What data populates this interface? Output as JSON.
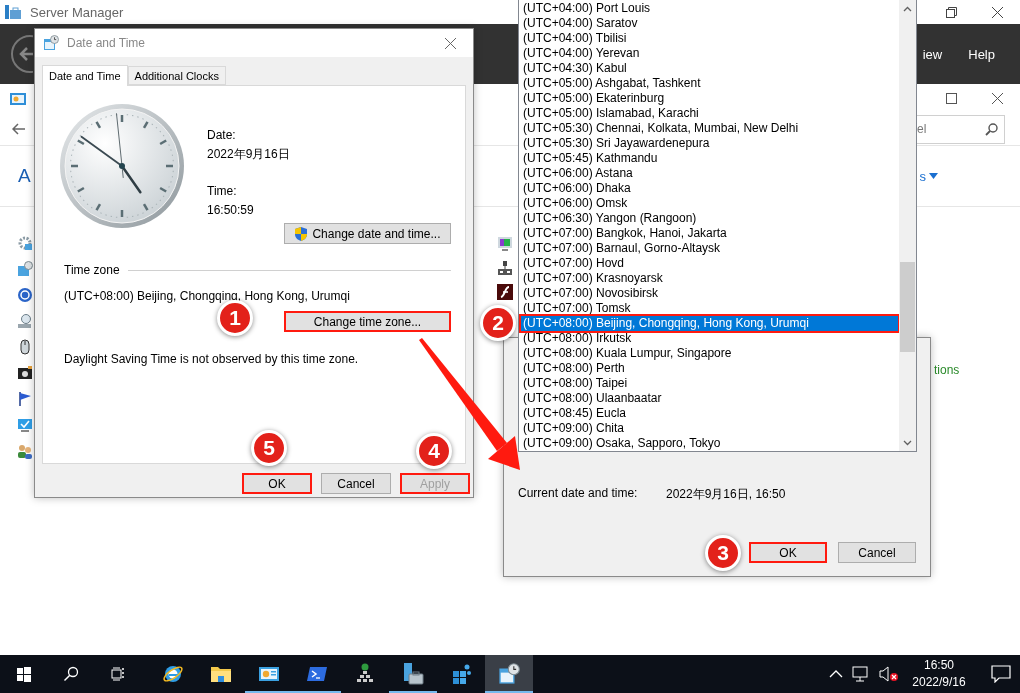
{
  "server_manager": {
    "title": "Server Manager",
    "menu": [
      "iew",
      "Help"
    ]
  },
  "control_panel": {
    "heading": "A",
    "search": {
      "placeholder": "el"
    },
    "view_link": "s",
    "side_link": "tions"
  },
  "date_time_dialog": {
    "title": "Date and Time",
    "tabs": [
      {
        "label": "Date and Time",
        "selected": true
      },
      {
        "label": "Additional Clocks",
        "selected": false
      }
    ],
    "date_label": "Date:",
    "date": "2022年9月16日",
    "time_label": "Time:",
    "time": "16:50:59",
    "change_date_button": {
      "label": "Change date and time...",
      "highlighted": false
    },
    "time_zone_heading": "Time zone",
    "time_zone": "(UTC+08:00) Beijing, Chongqing, Hong Kong, Urumqi",
    "change_zone_button": {
      "label": "Change time zone...",
      "highlighted": true
    },
    "dst_note": "Daylight Saving Time is not observed by this time zone.",
    "buttons": [
      {
        "label": "OK",
        "disabled": false,
        "highlighted": true
      },
      {
        "label": "Cancel",
        "disabled": false,
        "highlighted": false
      },
      {
        "label": "Apply",
        "disabled": true,
        "highlighted": true
      }
    ]
  },
  "time_zone_dialog": {
    "time_zones": [
      {
        "label": "(UTC+04:00) Port Louis",
        "selected": false
      },
      {
        "label": "(UTC+04:00) Saratov",
        "selected": false
      },
      {
        "label": "(UTC+04:00) Tbilisi",
        "selected": false
      },
      {
        "label": "(UTC+04:00) Yerevan",
        "selected": false
      },
      {
        "label": "(UTC+04:30) Kabul",
        "selected": false
      },
      {
        "label": "(UTC+05:00) Ashgabat, Tashkent",
        "selected": false
      },
      {
        "label": "(UTC+05:00) Ekaterinburg",
        "selected": false
      },
      {
        "label": "(UTC+05:00) Islamabad, Karachi",
        "selected": false
      },
      {
        "label": "(UTC+05:30) Chennai, Kolkata, Mumbai, New Delhi",
        "selected": false
      },
      {
        "label": "(UTC+05:30) Sri Jayawardenepura",
        "selected": false
      },
      {
        "label": "(UTC+05:45) Kathmandu",
        "selected": false
      },
      {
        "label": "(UTC+06:00) Astana",
        "selected": false
      },
      {
        "label": "(UTC+06:00) Dhaka",
        "selected": false
      },
      {
        "label": "(UTC+06:00) Omsk",
        "selected": false
      },
      {
        "label": "(UTC+06:30) Yangon (Rangoon)",
        "selected": false
      },
      {
        "label": "(UTC+07:00) Bangkok, Hanoi, Jakarta",
        "selected": false
      },
      {
        "label": "(UTC+07:00) Barnaul, Gorno-Altaysk",
        "selected": false
      },
      {
        "label": "(UTC+07:00) Hovd",
        "selected": false
      },
      {
        "label": "(UTC+07:00) Krasnoyarsk",
        "selected": false
      },
      {
        "label": "(UTC+07:00) Novosibirsk",
        "selected": false
      },
      {
        "label": "(UTC+07:00) Tomsk",
        "selected": false
      },
      {
        "label": "(UTC+08:00) Beijing, Chongqing, Hong Kong, Urumqi",
        "selected": true
      },
      {
        "label": "(UTC+08:00) Irkutsk",
        "selected": false
      },
      {
        "label": "(UTC+08:00) Kuala Lumpur, Singapore",
        "selected": false
      },
      {
        "label": "(UTC+08:00) Perth",
        "selected": false
      },
      {
        "label": "(UTC+08:00) Taipei",
        "selected": false
      },
      {
        "label": "(UTC+08:00) Ulaanbaatar",
        "selected": false
      },
      {
        "label": "(UTC+08:45) Eucla",
        "selected": false
      },
      {
        "label": "(UTC+09:00) Chita",
        "selected": false
      },
      {
        "label": "(UTC+09:00) Osaka, Sapporo, Tokyo",
        "selected": false
      }
    ],
    "current_label": "Current date and time:",
    "current_value": "2022年9月16日, 16:50",
    "buttons": [
      {
        "label": "OK",
        "highlighted": true,
        "default": true
      },
      {
        "label": "Cancel",
        "highlighted": false,
        "default": false
      }
    ]
  },
  "annotations": [
    {
      "number": "1"
    },
    {
      "number": "2"
    },
    {
      "number": "3"
    },
    {
      "number": "4"
    },
    {
      "number": "5"
    }
  ],
  "taskbar": {
    "apps": [
      {
        "kind": "start",
        "running": false,
        "active": false
      },
      {
        "kind": "search",
        "running": false,
        "active": false
      },
      {
        "kind": "taskview",
        "running": false,
        "active": false
      },
      {
        "kind": "browser",
        "running": false,
        "active": false
      },
      {
        "kind": "folder",
        "running": false,
        "active": false
      },
      {
        "kind": "controlpanel",
        "running": true,
        "active": false
      },
      {
        "kind": "terminal",
        "running": true,
        "active": false
      },
      {
        "kind": "network",
        "running": false,
        "active": false
      },
      {
        "kind": "servertools",
        "running": true,
        "active": false
      },
      {
        "kind": "cube",
        "running": false,
        "active": false
      },
      {
        "kind": "clockapp",
        "running": true,
        "active": true
      }
    ],
    "time": "16:50",
    "date": "2022/9/16"
  }
}
